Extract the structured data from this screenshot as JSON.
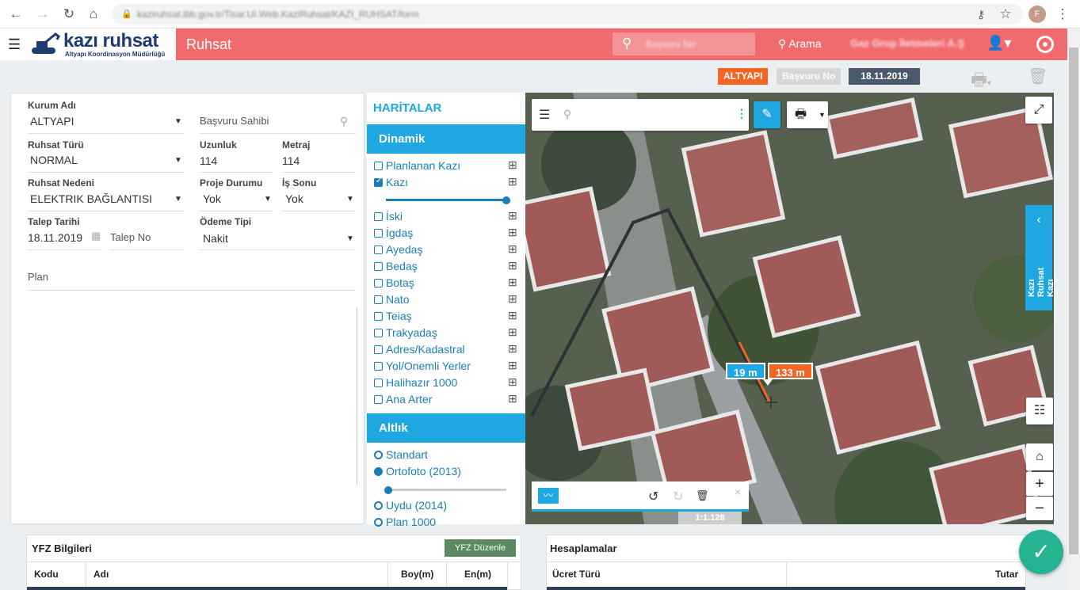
{
  "browser": {
    "url": "kaziruhsat.ibb.gov.tr/Tisar.UI.Web.KaziRuhsat/KAZI_RUHSAT/form",
    "avatar_letter": "F"
  },
  "header": {
    "logo_title": "kazı ruhsat",
    "logo_subtitle": "Altyapı Koordinasyon Müdürlüğü",
    "page_title": "Ruhsat",
    "search_placeholder": "Başvuru No",
    "search_label": "Arama",
    "user_name": "Gaz Grup İletmeleri A.Ş"
  },
  "badges": {
    "type": "ALTYAPI",
    "basvuru_no": "Başvuru No",
    "date": "18.11.2019"
  },
  "colors": {
    "header": "#ef6b6e",
    "accent": "#1ea7e1",
    "badge_type": "#f26522",
    "badge_date": "#4b5a6b",
    "fab": "#26b392",
    "length_label": "#1ea7e1",
    "total_label": "#f26522"
  },
  "form": {
    "kurum_adi": {
      "label": "Kurum Adı",
      "value": "ALTYAPI"
    },
    "basvuru_sahibi": {
      "placeholder": "Başvuru Sahibi"
    },
    "ruhsat_turu": {
      "label": "Ruhsat Türü",
      "value": "NORMAL"
    },
    "uzunluk": {
      "label": "Uzunluk",
      "value": "114"
    },
    "metraj": {
      "label": "Metraj",
      "value": "114"
    },
    "ruhsat_nedeni": {
      "label": "Ruhsat Nedeni",
      "value": "ELEKTRIK BAĞLANTISI"
    },
    "proje_durumu": {
      "label": "Proje Durumu",
      "value": "Yok"
    },
    "is_sonu": {
      "label": "İş Sonu",
      "value": "Yok"
    },
    "talep_tarihi": {
      "label": "Talep Tarihi",
      "value": "18.11.2019"
    },
    "talep_no": {
      "placeholder": "Talep No"
    },
    "odeme_tipi": {
      "label": "Ödeme Tipi",
      "value": "Nakit"
    },
    "plan": {
      "placeholder": "Plan"
    }
  },
  "haritalar": {
    "title": "HARİTALAR",
    "dinamik_title": "Dinamik",
    "dinamik": [
      {
        "label": "Planlanan Kazı",
        "checked": false
      },
      {
        "label": "Kazı",
        "checked": true
      },
      {
        "label": "İski",
        "checked": false
      },
      {
        "label": "İgdaş",
        "checked": false
      },
      {
        "label": "Ayedaş",
        "checked": false
      },
      {
        "label": "Bedaş",
        "checked": false
      },
      {
        "label": "Botaş",
        "checked": false
      },
      {
        "label": "Nato",
        "checked": false
      },
      {
        "label": "Teiaş",
        "checked": false
      },
      {
        "label": "Trakyadaş",
        "checked": false
      },
      {
        "label": "Adres/Kadastral",
        "checked": false
      },
      {
        "label": "Yol/Onemli Yerler",
        "checked": false
      },
      {
        "label": "Halihazır 1000",
        "checked": false
      },
      {
        "label": "Ana Arter",
        "checked": false
      }
    ],
    "kazi_opacity": 1.0,
    "altlik_title": "Altlık",
    "altlik": [
      {
        "label": "Standart",
        "selected": false
      },
      {
        "label": "Ortofoto (2013)",
        "selected": true
      },
      {
        "label": "Uydu (2014)",
        "selected": false
      },
      {
        "label": "Plan 1000",
        "selected": false
      }
    ],
    "ortofoto_opacity": 0.0
  },
  "map": {
    "segment_length": "19 m",
    "total_length": "133 m",
    "side_tab_label": "Kazı Ruhsat Kazı",
    "scale": "1:1.128"
  },
  "bottom": {
    "yfz_title": "YFZ Bilgileri",
    "yfz_button": "YFZ Düzenle",
    "yfz_columns": [
      "Kodu",
      "Adı",
      "Boy(m)",
      "En(m)"
    ],
    "hesap_title": "Hesaplamalar",
    "hesap_columns": [
      "Ücret Türü",
      "Tutar"
    ]
  }
}
